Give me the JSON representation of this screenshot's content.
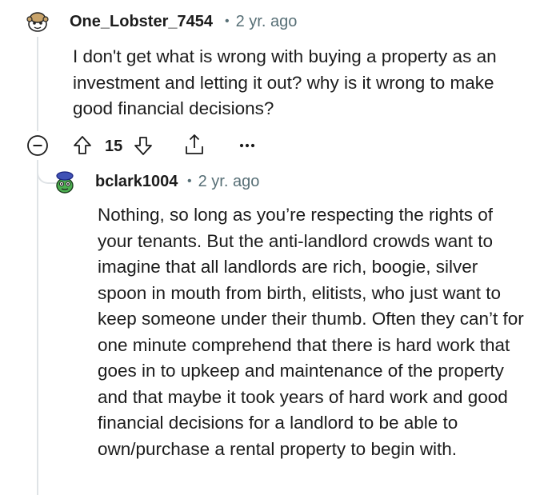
{
  "comments": [
    {
      "username": "One_Lobster_7454",
      "age": "2 yr. ago",
      "text": "I don't get what is wrong with buying a property as an investment and letting it out? why is it wrong to make good financial decisions?",
      "votes": "15",
      "avatar_icon": "snoo-avatar-icon"
    },
    {
      "username": "bclark1004",
      "age": "2 yr. ago",
      "text": "Nothing, so long as you’re respecting the rights of your tenants. But the anti-landlord crowds want to imagine that all landlords are rich, boogie, silver spoon in mouth from birth, elitists, who just want to keep someone under their thumb. Often they can’t for one minute comprehend that there is hard work that goes in to upkeep and maintenance of the property and that maybe it took years of hard work and good financial decisions for a landlord to be able to own/purchase a rental property to begin with.",
      "avatar_icon": "snoo-avatar-icon"
    }
  ],
  "actions": {
    "collapse_icon": "collapse-minus-icon",
    "upvote_icon": "upvote-arrow-icon",
    "downvote_icon": "downvote-arrow-icon",
    "share_icon": "share-icon",
    "more_icon": "more-options-icon"
  },
  "colors": {
    "meta": "#576f76",
    "thread_line": "#dfe3e6",
    "text": "#1c1c1c"
  }
}
